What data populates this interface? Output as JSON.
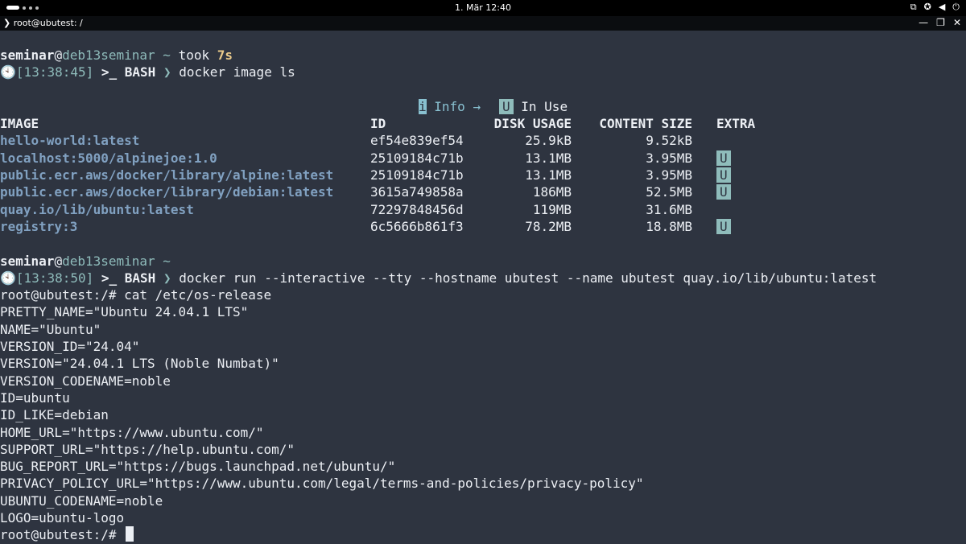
{
  "system_bar": {
    "clock": "1. Mär 12:40",
    "tray_icons": [
      "network-icon",
      "accessibility-icon",
      "volume-icon",
      "power-icon"
    ]
  },
  "window": {
    "title": "root@ubutest: /",
    "buttons": [
      "—",
      "❐",
      "✕"
    ]
  },
  "prompt1": {
    "user": "seminar",
    "at": "@",
    "host": "deb13seminar",
    "cwd": " ~",
    "took_label": " took ",
    "took": "7s",
    "time": "[13:38:45]",
    "shell": " >_ BASH ",
    "arrow": "❯",
    "command": " docker image ls"
  },
  "image_legend": {
    "info_icon": "i",
    "info_label": " Info →",
    "in_use_badge": "U",
    "in_use_label": " In Use"
  },
  "image_table": {
    "headers": {
      "image": "IMAGE",
      "id": "ID",
      "disk": "DISK USAGE",
      "content": "CONTENT SIZE",
      "extra": "EXTRA"
    },
    "rows": [
      {
        "image": "hello-world:latest",
        "id": "ef54e839ef54",
        "disk": "25.9kB",
        "content": "9.52kB",
        "extra": ""
      },
      {
        "image": "localhost:5000/alpinejoe:1.0",
        "id": "25109184c71b",
        "disk": "13.1MB",
        "content": "3.95MB",
        "extra": "U"
      },
      {
        "image": "public.ecr.aws/docker/library/alpine:latest",
        "id": "25109184c71b",
        "disk": "13.1MB",
        "content": "3.95MB",
        "extra": "U"
      },
      {
        "image": "public.ecr.aws/docker/library/debian:latest",
        "id": "3615a749858a",
        "disk": "186MB",
        "content": "52.5MB",
        "extra": "U"
      },
      {
        "image": "quay.io/lib/ubuntu:latest",
        "id": "72297848456d",
        "disk": "119MB",
        "content": "31.6MB",
        "extra": ""
      },
      {
        "image": "registry:3",
        "id": "6c5666b861f3",
        "disk": "78.2MB",
        "content": "18.8MB",
        "extra": "U"
      }
    ]
  },
  "prompt2": {
    "user": "seminar",
    "at": "@",
    "host": "deb13seminar",
    "cwd": " ~",
    "time": "[13:38:50]",
    "shell": " >_ BASH ",
    "arrow": "❯",
    "command": " docker run --interactive --tty --hostname ubutest --name ubutest quay.io/lib/ubuntu:latest"
  },
  "container_lines": [
    "root@ubutest:/# cat /etc/os-release",
    "PRETTY_NAME=\"Ubuntu 24.04.1 LTS\"",
    "NAME=\"Ubuntu\"",
    "VERSION_ID=\"24.04\"",
    "VERSION=\"24.04.1 LTS (Noble Numbat)\"",
    "VERSION_CODENAME=noble",
    "ID=ubuntu",
    "ID_LIKE=debian",
    "HOME_URL=\"https://www.ubuntu.com/\"",
    "SUPPORT_URL=\"https://help.ubuntu.com/\"",
    "BUG_REPORT_URL=\"https://bugs.launchpad.net/ubuntu/\"",
    "PRIVACY_POLICY_URL=\"https://www.ubuntu.com/legal/terms-and-policies/privacy-policy\"",
    "UBUNTU_CODENAME=noble",
    "LOGO=ubuntu-logo"
  ],
  "final_prompt": "root@ubutest:/# ",
  "colors": {
    "background": "#2e3440",
    "foreground": "#eceff4",
    "accent": "#8fbcbb",
    "image_name": "#81a1c1",
    "took": "#ebcb8b"
  }
}
